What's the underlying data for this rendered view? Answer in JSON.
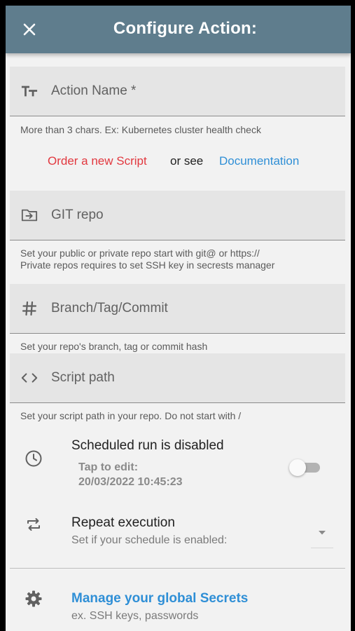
{
  "appbar": {
    "title": "Configure Action:",
    "close_icon": "close-icon"
  },
  "fields": {
    "action_name": {
      "label": "Action Name *",
      "icon": "text-fields-icon",
      "helper": "More than 3 chars. Ex: Kubernetes cluster health check"
    },
    "git_repo": {
      "label": "GIT repo",
      "icon": "folder-arrow-icon",
      "helper_line1": "Set your public or private repo start with git@ or https://",
      "helper_line2": "Private repos requires to set SSH key in secrests manager"
    },
    "branch": {
      "label": "Branch/Tag/Commit",
      "icon": "hash-icon",
      "helper": "Set your repo's  branch, tag or commit hash"
    },
    "script_path": {
      "label": "Script path",
      "icon": "code-icon",
      "helper": "Set your script path in your repo. Do not start with /"
    }
  },
  "links": {
    "order_script": "Order a new Script",
    "or_see": "or see",
    "documentation": "Documentation"
  },
  "schedule": {
    "title": "Scheduled run is disabled",
    "tap_hint": "Tap to edit:",
    "datetime": "20/03/2022 10:45:23",
    "enabled": false,
    "icon": "clock-icon"
  },
  "repeat": {
    "title": "Repeat execution",
    "subtitle": "Set if your schedule is enabled:",
    "icon": "repeat-icon",
    "selected_value": ""
  },
  "secrets": {
    "title": "Manage your global Secrets",
    "subtitle": "ex. SSH keys, passwords",
    "icon": "gear-icon"
  },
  "colors": {
    "appbar": "#5f7d8d",
    "link_red": "#e2383f",
    "link_blue": "#2f8fd6",
    "background": "#f2f2f2",
    "field_fill": "#e5e5e5"
  }
}
